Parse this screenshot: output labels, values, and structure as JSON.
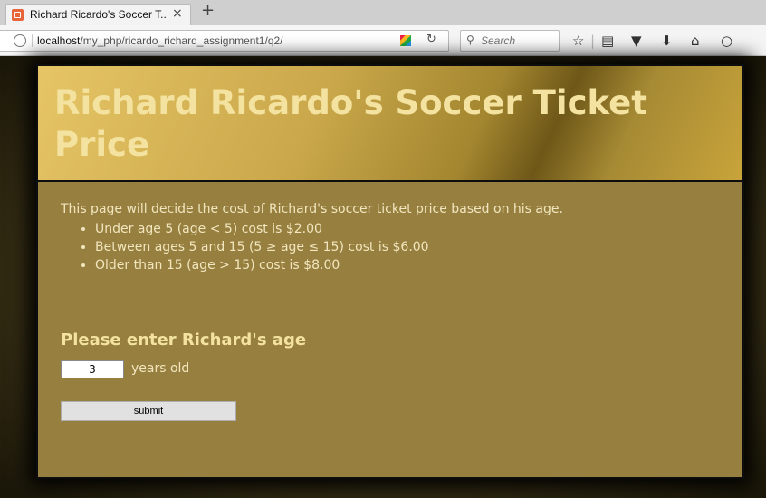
{
  "browser": {
    "tab_title": "Richard Ricardo's Soccer T...",
    "tab_close": "×",
    "new_tab": "+",
    "url_host": "localhost",
    "url_path": "/my_php/ricardo_richard_assignment1/q2/",
    "search_placeholder": "Search",
    "icons": [
      "favicon-icon",
      "globe-icon",
      "site-icon",
      "reload-icon",
      "search-icon",
      "star-icon",
      "reading-list-icon",
      "pocket-icon",
      "download-icon",
      "home-icon",
      "chat-icon"
    ]
  },
  "page": {
    "title": "Richard Ricardo's Soccer Ticket Price",
    "intro": "This page will decide the cost of Richard's soccer ticket price based on his age.",
    "rules": [
      "Under age 5 (age < 5) cost is $2.00",
      "Between ages 5 and 15 (5 ≥ age ≤ 15) cost is $6.00",
      "Older than 15 (age > 15) cost is $8.00"
    ],
    "prompt": "Please enter Richard's age",
    "age_value": "3",
    "unit_label": "years old",
    "submit_label": "submit"
  },
  "colors": {
    "card_bg": "#977f3f",
    "title_text": "#f4e3a0",
    "body_text": "#f1e6be"
  }
}
